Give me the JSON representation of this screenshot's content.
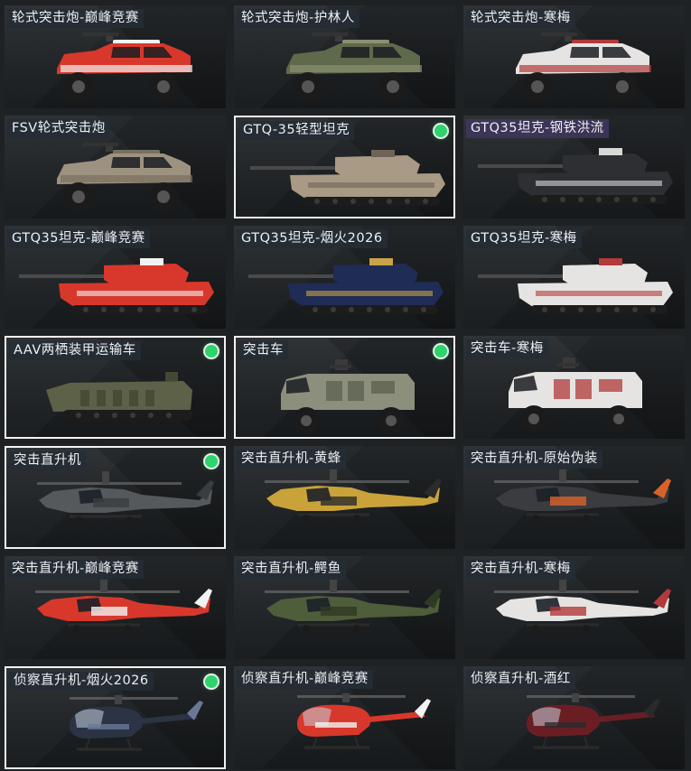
{
  "items": [
    {
      "label": "轮式突击炮-巅峰竞赛",
      "vehicle": "armored-car",
      "body": "#d8382b",
      "trim": "#f2f2f2",
      "selected": false,
      "owned": false
    },
    {
      "label": "轮式突击炮-护林人",
      "vehicle": "armored-car",
      "body": "#5f6a4c",
      "trim": "#8a9072",
      "selected": false,
      "owned": false
    },
    {
      "label": "轮式突击炮-寒梅",
      "vehicle": "armored-car",
      "body": "#e6e4e2",
      "trim": "#b23a3a",
      "selected": false,
      "owned": false
    },
    {
      "label": "FSV轮式突击炮",
      "vehicle": "armored-car",
      "body": "#9d9280",
      "trim": "#7a7060",
      "selected": false,
      "owned": false
    },
    {
      "label": "GTQ-35轻型坦克",
      "vehicle": "tank",
      "body": "#a89a84",
      "trim": "#6e6456",
      "selected": true,
      "owned": true
    },
    {
      "label": "GTQ35坦克-钢铁洪流",
      "vehicle": "tank",
      "body": "#2d2f33",
      "trim": "#d9d9d9",
      "selected": false,
      "owned": false,
      "tint": "purple"
    },
    {
      "label": "GTQ35坦克-巅峰竞赛",
      "vehicle": "tank",
      "body": "#d8382b",
      "trim": "#f2f2f2",
      "selected": false,
      "owned": false
    },
    {
      "label": "GTQ35坦克-烟火2026",
      "vehicle": "tank",
      "body": "#1f2c55",
      "trim": "#c9a24a",
      "selected": false,
      "owned": false
    },
    {
      "label": "GTQ35坦克-寒梅",
      "vehicle": "tank",
      "body": "#e6e4e2",
      "trim": "#b23a3a",
      "selected": false,
      "owned": false
    },
    {
      "label": "AAV两栖装甲运输车",
      "vehicle": "amphibious",
      "body": "#5c6148",
      "trim": "#444834",
      "selected": true,
      "owned": true
    },
    {
      "label": "突击车",
      "vehicle": "assault-truck",
      "body": "#8b8f7c",
      "trim": "#5c604f",
      "selected": true,
      "owned": true
    },
    {
      "label": "突击车-寒梅",
      "vehicle": "assault-truck",
      "body": "#e6e4e2",
      "trim": "#b23a3a",
      "selected": false,
      "owned": false
    },
    {
      "label": "突击直升机",
      "vehicle": "attack-heli",
      "body": "#55595c",
      "trim": "#3a3d40",
      "selected": true,
      "owned": true
    },
    {
      "label": "突击直升机-黄蜂",
      "vehicle": "attack-heli",
      "body": "#c9a33a",
      "trim": "#2b2b2b",
      "selected": false,
      "owned": false
    },
    {
      "label": "突击直升机-原始伪装",
      "vehicle": "attack-heli",
      "body": "#3a3c40",
      "trim": "#d9622a",
      "selected": false,
      "owned": false
    },
    {
      "label": "突击直升机-巅峰竞赛",
      "vehicle": "attack-heli",
      "body": "#d8382b",
      "trim": "#f2f2f2",
      "selected": false,
      "owned": false
    },
    {
      "label": "突击直升机-鳄鱼",
      "vehicle": "attack-heli",
      "body": "#4e5d3a",
      "trim": "#2f3a24",
      "selected": false,
      "owned": false
    },
    {
      "label": "突击直升机-寒梅",
      "vehicle": "attack-heli",
      "body": "#e6e4e2",
      "trim": "#b23a3a",
      "selected": false,
      "owned": false
    },
    {
      "label": "侦察直升机-烟火2026",
      "vehicle": "scout-heli",
      "body": "#2b3345",
      "trim": "#6a7896",
      "selected": true,
      "owned": true
    },
    {
      "label": "侦察直升机-巅峰竞赛",
      "vehicle": "scout-heli",
      "body": "#d8382b",
      "trim": "#f2f2f2",
      "selected": false,
      "owned": false
    },
    {
      "label": "侦察直升机-酒红",
      "vehicle": "scout-heli",
      "body": "#6a1e24",
      "trim": "#2a2a2a",
      "selected": false,
      "owned": false
    }
  ]
}
